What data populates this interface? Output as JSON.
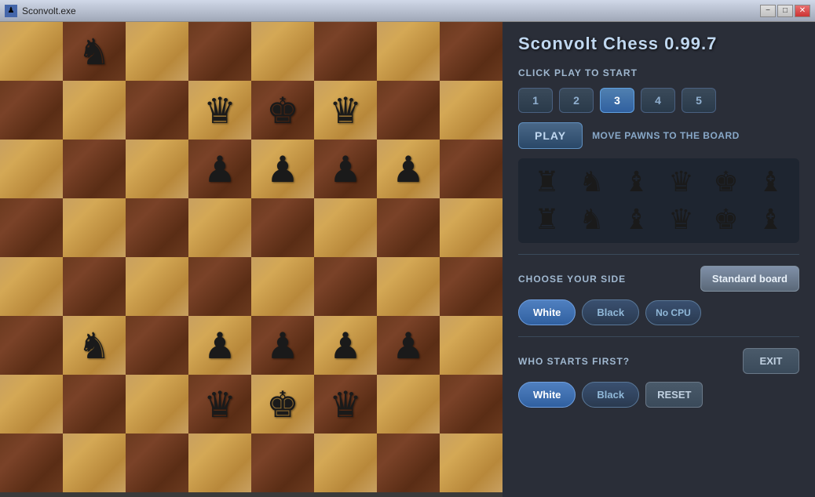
{
  "window": {
    "title": "Sconvolt.exe",
    "controls": [
      "−",
      "□",
      "✕"
    ]
  },
  "app": {
    "title": "Sconvolt Chess 0.99.7",
    "click_to_start": "CLICK PLAY TO START",
    "difficulty_levels": [
      "1",
      "2",
      "3",
      "4",
      "5"
    ],
    "active_difficulty": 2,
    "play_label": "PLAY",
    "move_hint": "MOVE PAWNS TO THE BOARD",
    "choose_side_label": "CHOOSE YOUR SIDE",
    "who_starts_label": "WHO STARTS FIRST?",
    "standard_board_label": "Standard board",
    "side_buttons": [
      "White",
      "Black",
      "No CPU"
    ],
    "active_side": 0,
    "start_buttons": [
      "White",
      "Black"
    ],
    "active_start": 0,
    "exit_label": "EXIT",
    "reset_label": "RESET"
  },
  "board": {
    "pieces": [
      [
        "",
        "♞",
        "",
        "",
        "",
        "",
        "",
        ""
      ],
      [
        "",
        "",
        "",
        "♛",
        "♚",
        "♛",
        "",
        ""
      ],
      [
        "",
        "",
        "",
        "♟",
        "♟",
        "♟",
        "♟",
        ""
      ],
      [
        "",
        "",
        "",
        "",
        "",
        "",
        "",
        ""
      ],
      [
        "",
        "",
        "",
        "",
        "",
        "",
        "",
        ""
      ],
      [
        "",
        "♞",
        "",
        "♟",
        "♟",
        "♟",
        "♟",
        ""
      ],
      [
        "",
        "",
        "",
        "♛",
        "♚",
        "♛",
        "",
        ""
      ],
      [
        "",
        "",
        "",
        "",
        "",
        "",
        "",
        ""
      ]
    ]
  },
  "palette": {
    "row1": [
      "♜",
      "♞",
      "♝",
      "♛",
      "♚",
      "♝"
    ],
    "row2": [
      "♜",
      "♞",
      "♝",
      "♛",
      "♚",
      "♝"
    ]
  }
}
